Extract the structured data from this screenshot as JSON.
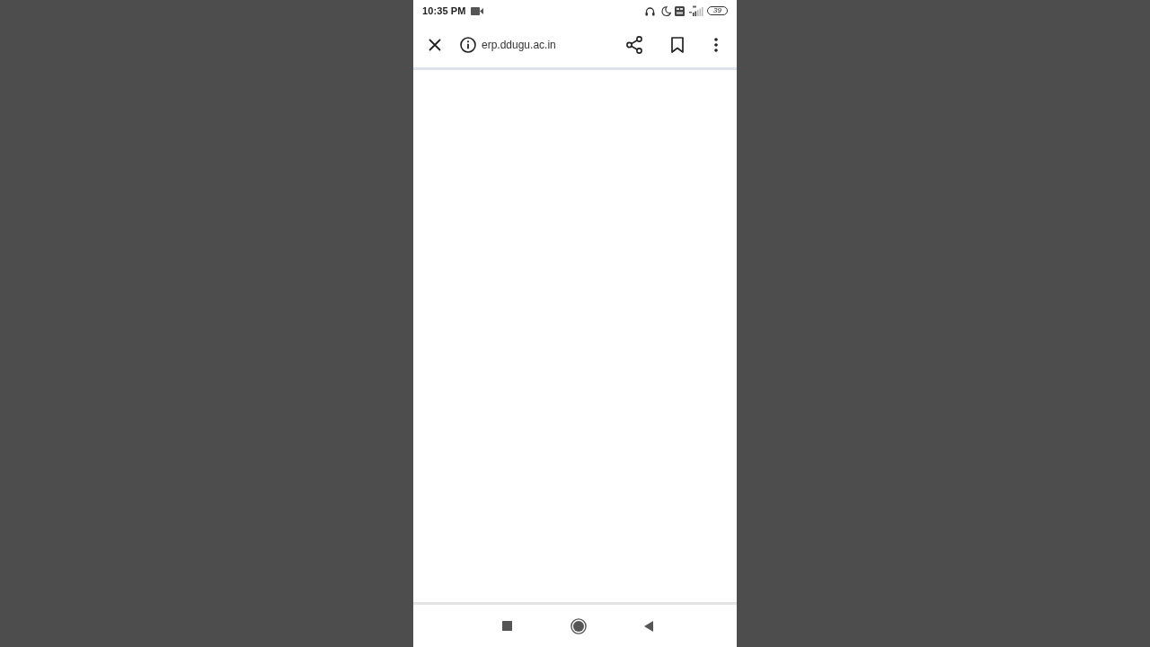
{
  "status_bar": {
    "time": "10:35 PM",
    "battery": "39"
  },
  "toolbar": {
    "url": "erp.ddugu.ac.in"
  }
}
